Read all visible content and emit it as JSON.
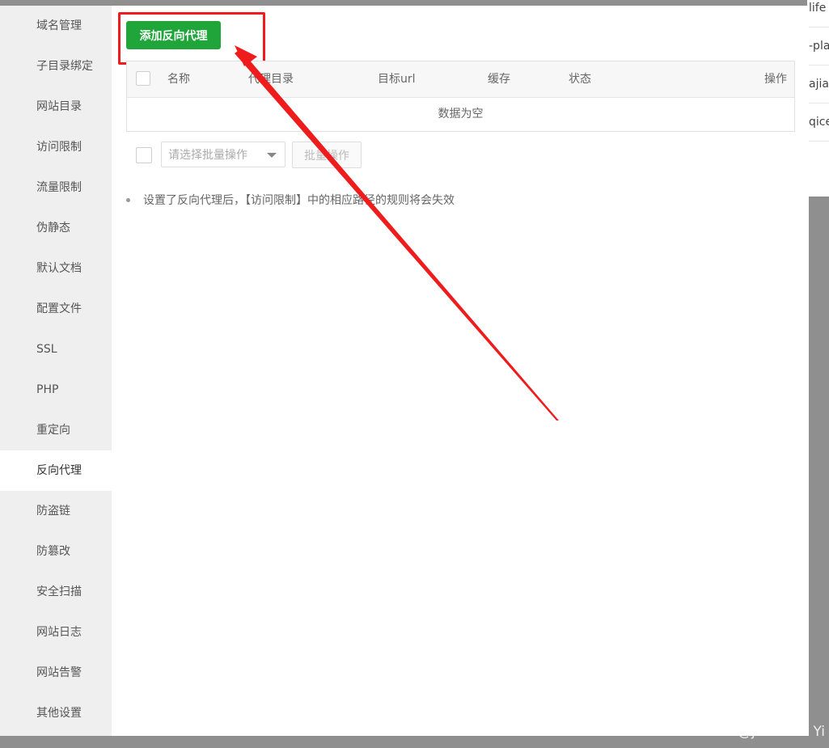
{
  "background_rows": [
    "life",
    "-pla",
    "ajian",
    "qice"
  ],
  "sidebar": {
    "items": [
      {
        "label": "域名管理"
      },
      {
        "label": "子目录绑定"
      },
      {
        "label": "网站目录"
      },
      {
        "label": "访问限制"
      },
      {
        "label": "流量限制"
      },
      {
        "label": "伪静态"
      },
      {
        "label": "默认文档"
      },
      {
        "label": "配置文件"
      },
      {
        "label": "SSL"
      },
      {
        "label": "PHP"
      },
      {
        "label": "重定向"
      },
      {
        "label": "反向代理",
        "active": true
      },
      {
        "label": "防盗链"
      },
      {
        "label": "防篡改"
      },
      {
        "label": "安全扫描"
      },
      {
        "label": "网站日志"
      },
      {
        "label": "网站告警"
      },
      {
        "label": "其他设置"
      }
    ]
  },
  "toolbar": {
    "add_label": "添加反向代理"
  },
  "table": {
    "columns": [
      "名称",
      "代理目录",
      "目标url",
      "缓存",
      "状态",
      "操作"
    ],
    "empty_text": "数据为空"
  },
  "batch": {
    "select_placeholder": "请选择批量操作",
    "button_label": "批量操作"
  },
  "tips": [
    "设置了反向代理后，【访问限制】中的相应路径的规则将会失效"
  ],
  "watermark": "CSDN @june-Dai Yi",
  "colors": {
    "accent": "#20a53a",
    "annotation": "#ee1c1c"
  }
}
